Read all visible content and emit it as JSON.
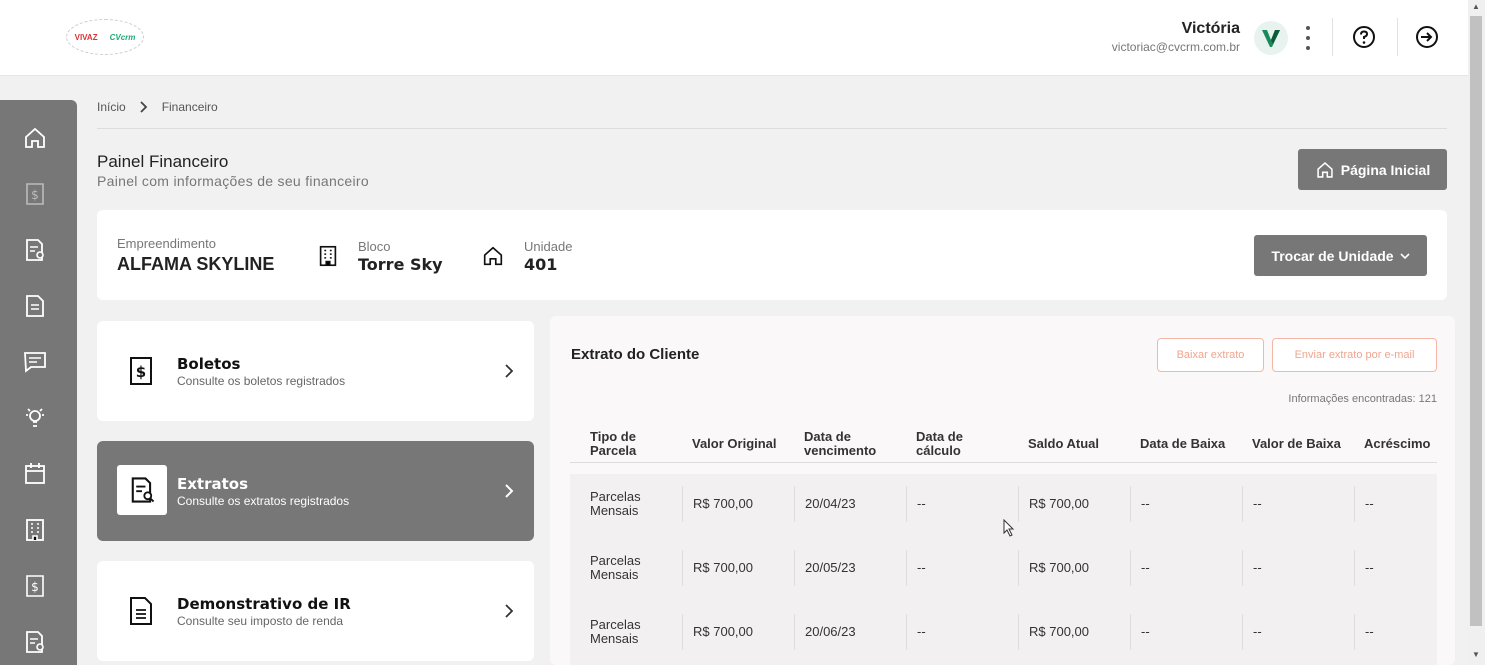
{
  "header": {
    "logo_text_1": "VIVAZ",
    "logo_text_2": "CVcrm",
    "user_name": "Victória",
    "user_email": "victoriac@cvcrm.com.br"
  },
  "breadcrumb": {
    "home": "Início",
    "current": "Financeiro"
  },
  "page": {
    "title": "Painel Financeiro",
    "subtitle": "Painel com informações de seu financeiro",
    "home_button": "Página Inicial"
  },
  "unit": {
    "empreendimento_label": "Empreendimento",
    "empreendimento_value": "ALFAMA SKYLINE",
    "bloco_label": "Bloco",
    "bloco_value": "Torre Sky",
    "unidade_label": "Unidade",
    "unidade_value": "401",
    "change_button": "Trocar de Unidade"
  },
  "nav_cards": [
    {
      "title": "Boletos",
      "subtitle": "Consulte os boletos registrados"
    },
    {
      "title": "Extratos",
      "subtitle": "Consulte os extratos registrados"
    },
    {
      "title": "Demonstrativo de IR",
      "subtitle": "Consulte seu imposto de renda"
    }
  ],
  "extrato": {
    "title": "Extrato do Cliente",
    "download_button": "Baixar extrato",
    "email_button": "Enviar extrato por e-mail",
    "count": "Informações encontradas: 121",
    "columns": [
      "Tipo de Parcela",
      "Valor Original",
      "Data de vencimento",
      "Data de cálculo",
      "Saldo Atual",
      "Data de Baixa",
      "Valor de Baixa",
      "Acréscimo"
    ],
    "rows": [
      [
        "Parcelas Mensais",
        "R$ 700,00",
        "20/04/23",
        "--",
        "R$ 700,00",
        "--",
        "--",
        "--"
      ],
      [
        "Parcelas Mensais",
        "R$ 700,00",
        "20/05/23",
        "--",
        "R$ 700,00",
        "--",
        "--",
        "--"
      ],
      [
        "Parcelas Mensais",
        "R$ 700,00",
        "20/06/23",
        "--",
        "R$ 700,00",
        "--",
        "--",
        "--"
      ]
    ]
  },
  "sidebar_icons": [
    "home-icon",
    "boleto-icon",
    "extrato-icon",
    "document-icon",
    "message-icon",
    "lightbulb-icon",
    "calendar-icon",
    "building-icon",
    "boleto-icon",
    "extrato-icon"
  ],
  "colors": {
    "accent_gray": "#777777",
    "outline_orange": "#f4b7a6",
    "brand_green": "#1a8a5a"
  }
}
